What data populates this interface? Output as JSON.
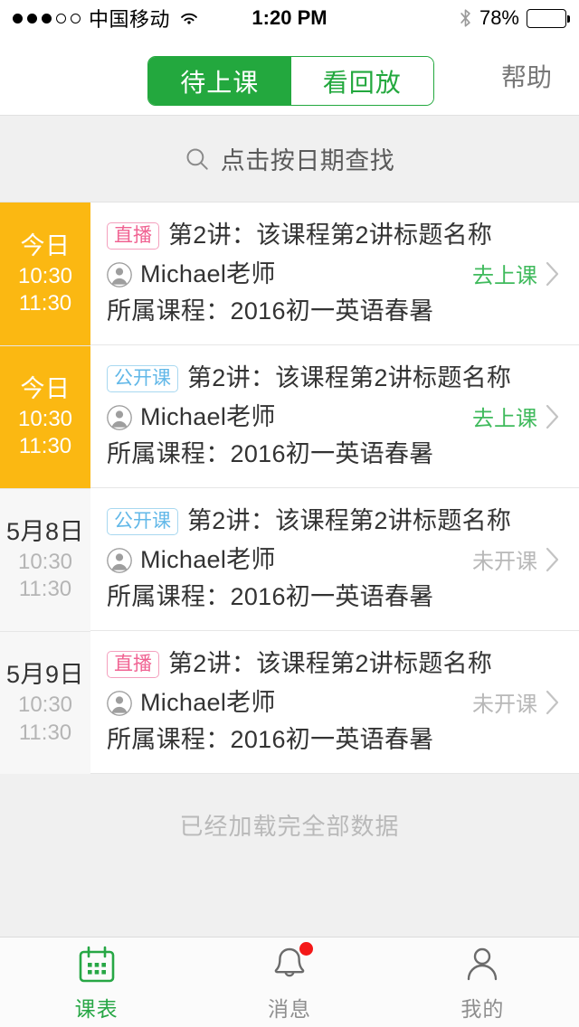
{
  "status_bar": {
    "signal_filled": 3,
    "signal_empty": 2,
    "carrier": "中国移动",
    "wifi_icon": "wifi-icon",
    "time": "1:20 PM",
    "bluetooth_icon": "bluetooth-icon",
    "battery_percent": "78%",
    "battery_level": 78
  },
  "navbar": {
    "segments": [
      {
        "label": "待上课",
        "active": true
      },
      {
        "label": "看回放",
        "active": false
      }
    ],
    "help_label": "帮助",
    "accent_color": "#23a83e"
  },
  "search": {
    "icon": "search-icon",
    "placeholder": "点击按日期查找"
  },
  "list": {
    "rows": [
      {
        "date_label": "今日",
        "time_start": "10:30",
        "time_end": "11:30",
        "highlight": true,
        "badge": {
          "text": "直播",
          "type": "live",
          "color": "#f06292"
        },
        "title": "第2讲：该课程第2讲标题名称",
        "teacher_icon": "avatar-icon",
        "teacher": "Michael老师",
        "course": "所属课程：2016初一英语春暑",
        "action": {
          "text": "去上课",
          "enabled": true,
          "color": "#3fba5c"
        }
      },
      {
        "date_label": "今日",
        "time_start": "10:30",
        "time_end": "11:30",
        "highlight": true,
        "badge": {
          "text": "公开课",
          "type": "open",
          "color": "#62b8e8"
        },
        "title": "第2讲：该课程第2讲标题名称",
        "teacher_icon": "avatar-icon",
        "teacher": "Michael老师",
        "course": "所属课程：2016初一英语春暑",
        "action": {
          "text": "去上课",
          "enabled": true,
          "color": "#3fba5c"
        }
      },
      {
        "date_label": "5月8日",
        "time_start": "10:30",
        "time_end": "11:30",
        "highlight": false,
        "badge": {
          "text": "公开课",
          "type": "open",
          "color": "#62b8e8"
        },
        "title": "第2讲：该课程第2讲标题名称",
        "teacher_icon": "avatar-icon",
        "teacher": "Michael老师",
        "course": "所属课程：2016初一英语春暑",
        "action": {
          "text": "未开课",
          "enabled": false,
          "color": "#b8b8b8"
        }
      },
      {
        "date_label": "5月9日",
        "time_start": "10:30",
        "time_end": "11:30",
        "highlight": false,
        "badge": {
          "text": "直播",
          "type": "live",
          "color": "#f06292"
        },
        "title": "第2讲：该课程第2讲标题名称",
        "teacher_icon": "avatar-icon",
        "teacher": "Michael老师",
        "course": "所属课程：2016初一英语春暑",
        "action": {
          "text": "未开课",
          "enabled": false,
          "color": "#b8b8b8"
        }
      }
    ],
    "footer_note": "已经加载完全部数据"
  },
  "tabbar": {
    "tabs": [
      {
        "label": "课表",
        "icon": "calendar-icon",
        "active": true,
        "badge": false
      },
      {
        "label": "消息",
        "icon": "bell-icon",
        "active": false,
        "badge": true
      },
      {
        "label": "我的",
        "icon": "person-icon",
        "active": false,
        "badge": false
      }
    ],
    "active_color": "#27a745",
    "inactive_color": "#8e8e8e",
    "badge_color": "#f41818"
  }
}
